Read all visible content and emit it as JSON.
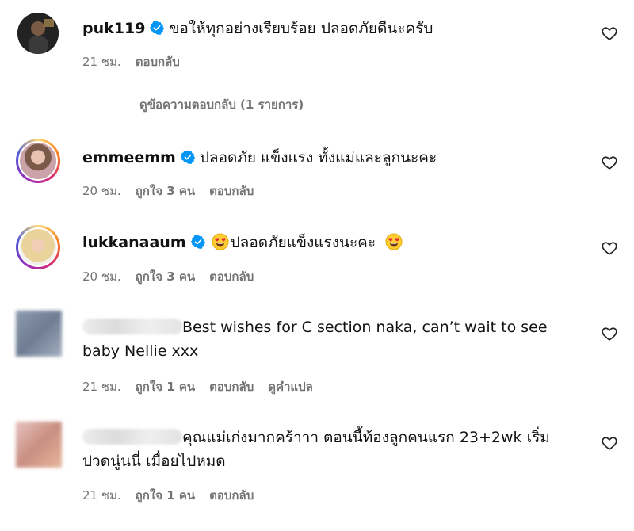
{
  "comments": [
    {
      "username": "puk119",
      "text": "ขอให้ทุกอย่างเรียบร้อย ปลอดภัยดีนะครับ",
      "time": "21 ชม.",
      "likes": "",
      "reply": "ตอบกลับ",
      "translate": ""
    },
    {
      "username": "emmeemm",
      "text": "ปลอดภัย แข็งแรง ทั้งแม่และลูกนะคะ",
      "time": "20 ชม.",
      "likes": "ถูกใจ 3 คน",
      "reply": "ตอบกลับ",
      "translate": ""
    },
    {
      "username": "lukkanaaum",
      "text": "ปลอดภัยแข็งแรงนะคะ",
      "time": "20 ชม.",
      "likes": "ถูกใจ 3 คน",
      "reply": "ตอบกลับ",
      "translate": ""
    },
    {
      "username": "",
      "text_line1": "Best wishes for C section naka, can’t wait to see",
      "text_line2": "baby Nellie xxx",
      "time": "21 ชม.",
      "likes": "ถูกใจ 1 คน",
      "reply": "ตอบกลับ",
      "translate": "ดูคำแปล"
    },
    {
      "username": "",
      "text_line1": "คุณแม่เก่งมากคร้าาา ตอนนี้ท้องลูกคนแรก 23+2wk เริ่ม",
      "text_line2": "ปวดนู่นนี่ เมื่อยไปหมด",
      "time": "21 ชม.",
      "likes": "ถูกใจ 1 คน",
      "reply": "ตอบกลับ",
      "translate": ""
    }
  ],
  "view_replies": "ดูข้อความตอบกลับ (1 รายการ)",
  "icons": {
    "verified": "verified-badge-icon",
    "heart": "heart-outline-icon",
    "emoji": "heart-eyes-emoji"
  },
  "colors": {
    "verified": "#0095f6",
    "meta_text": "#737373",
    "text": "#111111"
  }
}
